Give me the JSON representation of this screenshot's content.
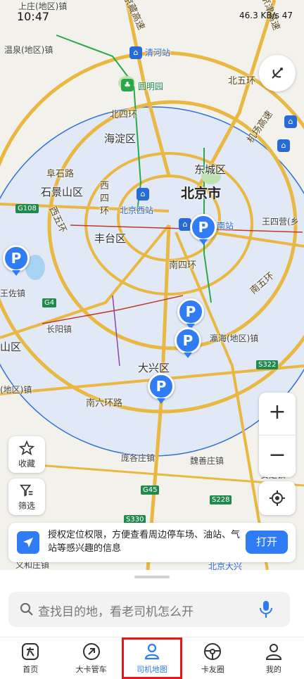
{
  "status_bar": {
    "time": "10:47",
    "right_text": "46.3 KB/s  47"
  },
  "map": {
    "labels": {
      "city": "北京市",
      "district_haidian": "海淀区",
      "district_dongcheng": "东城区",
      "district_shijingshan": "石景山区",
      "district_fengtai": "丰台区",
      "district_daxing": "大兴区",
      "district_fangshan": "山区",
      "town_wenquan": "温泉(地区)镇",
      "town_shangzhuang": "上庄(地区)镇",
      "town_wangzuo": "王佐镇",
      "town_changyang": "长阳镇",
      "town_yinghai": "瀛海(地区)镇",
      "town_wangsiying": "王四营(乡",
      "town_huangcun": "(地区)镇",
      "town_panggezhuang": "庞各庄镇",
      "town_weishanzhuang": "魏善庄镇",
      "town_anding": "安定镇",
      "town_yihe": "义和庄镇",
      "road_north4": "北四环",
      "road_north5": "北五环",
      "road_west4": "西四环",
      "road_west5": "西五环",
      "road_south4": "南四环",
      "road_south5": "南五环",
      "road_south6": "南六环路",
      "road_fushi": "阜石路",
      "road_jingcheng": "机场高速",
      "road_jingzang": "京藏高速",
      "road_jingjin": "京津高速",
      "station_qinghe": "清河站",
      "station_yuanmingyuan": "圆明园",
      "station_beijingxi": "北京西站",
      "station_nan": "南站",
      "station_daxing": "北京大兴",
      "shield_g108": "G108",
      "shield_g4": "G4",
      "shield_g45": "G45",
      "shield_s322": "S322",
      "shield_s228": "S228",
      "shield_s330": "S330"
    },
    "pin_symbol": "P"
  },
  "controls": {
    "favorites_label": "收藏",
    "filter_label": "筛选",
    "zoom_in": "+",
    "zoom_out": "−"
  },
  "banner": {
    "text": "授权定位权限，方便查看周边停车场、油站、气站等感兴趣的信息",
    "button": "打开"
  },
  "search": {
    "placeholder": "查找目的地，看老司机怎么开"
  },
  "tabs": [
    {
      "label": "首页",
      "icon": "home-icon"
    },
    {
      "label": "大卡管车",
      "icon": "truck-manage-icon"
    },
    {
      "label": "司机地图",
      "icon": "driver-map-icon"
    },
    {
      "label": "卡友圈",
      "icon": "steering-wheel-icon"
    },
    {
      "label": "我的",
      "icon": "profile-icon"
    }
  ],
  "colors": {
    "accent": "#2f7cf6",
    "highlight_box": "#e01919",
    "radius_fill": "#dbe6fb"
  }
}
